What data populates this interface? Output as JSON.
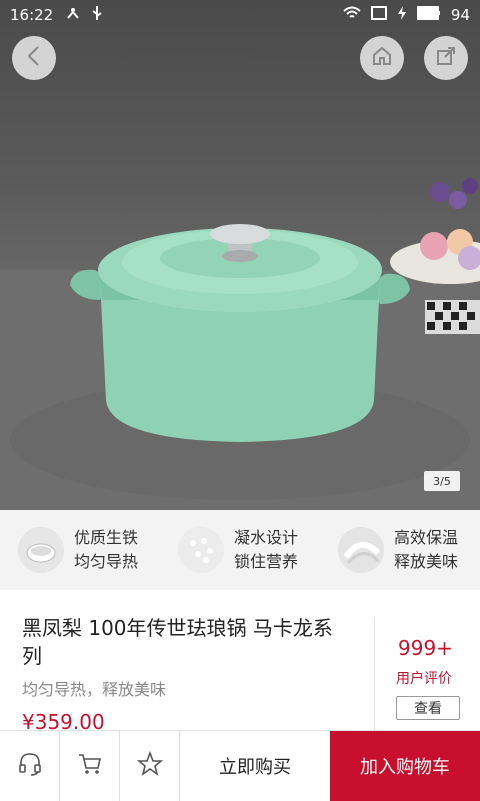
{
  "status_bar": {
    "time": "16:22",
    "battery": "94"
  },
  "gallery": {
    "page_indicator": "3/5"
  },
  "features": [
    {
      "line1": "优质生铁",
      "line2": "均匀导热"
    },
    {
      "line1": "凝水设计",
      "line2": "锁住营养"
    },
    {
      "line1": "高效保温",
      "line2": "释放美味"
    }
  ],
  "product": {
    "title": "黑凤梨 100年传世珐琅锅 马卡龙系列",
    "subtitle": "均匀导热，释放美味",
    "price": "¥359.00"
  },
  "reviews": {
    "count": "999+",
    "label": "用户评价",
    "view_button": "查看"
  },
  "bottom_bar": {
    "buy_now": "立即购买",
    "add_to_cart": "加入购物车"
  },
  "colors": {
    "accent": "#c8102e",
    "pot": "#8fd1b5"
  }
}
